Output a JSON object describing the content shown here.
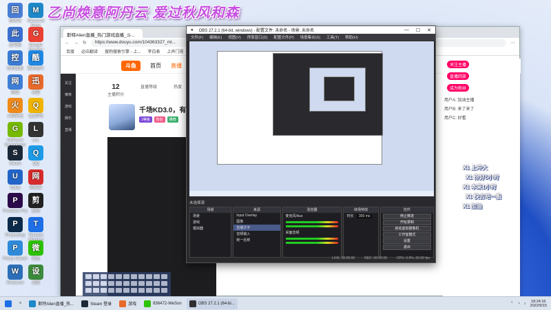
{
  "overlay": {
    "banner_text": "乙尚焕意阿丹云 爱过秋风和森"
  },
  "desktop_icons": [
    {
      "label": "回收站",
      "color": "#4a7fd8"
    },
    {
      "label": "Microsoft Edge",
      "color": "#1e88c8"
    },
    {
      "label": "此电脑",
      "color": "#3a6fd0"
    },
    {
      "label": "Google Chrome",
      "color": "#e94235"
    },
    {
      "label": "控制面板",
      "color": "#3b7bd4"
    },
    {
      "label": "酷狗音乐",
      "color": "#1e88e5"
    },
    {
      "label": "网络",
      "color": "#3f7fd6"
    },
    {
      "label": "迅雷",
      "color": "#e86a2b"
    },
    {
      "label": "火绒安全",
      "color": "#f08a1a"
    },
    {
      "label": "QQ游戏",
      "color": "#f0b400"
    },
    {
      "label": "GeForce Experience",
      "color": "#76b900"
    },
    {
      "label": "LoL",
      "color": "#333333"
    },
    {
      "label": "Steam",
      "color": "#1b2838"
    },
    {
      "label": "QQ",
      "color": "#1e9be6"
    },
    {
      "label": "Uplay",
      "color": "#2364c8"
    },
    {
      "label": "网易云",
      "color": "#d82b2b"
    },
    {
      "label": "Premiere Pro",
      "color": "#2a0a4a"
    },
    {
      "label": "剪映",
      "color": "#222222"
    },
    {
      "label": "Photoshop",
      "color": "#0b2a4a"
    },
    {
      "label": "Tencent Meeting",
      "color": "#1f6fe6"
    },
    {
      "label": "Photo Viewer",
      "color": "#2f8ad8"
    },
    {
      "label": "微信",
      "color": "#2dc100"
    },
    {
      "label": "WeGame",
      "color": "#2c6fb8"
    },
    {
      "label": "设置",
      "color": "#3c8b3c"
    }
  ],
  "browser": {
    "tab_title": "斯特Alien直播_热门游戏直播_斗...",
    "url": "https://www.douyu.com/104363327_ml...",
    "bookmarks": [
      "百度",
      "必应翻译",
      "搜狗搜索引擎 - 上...",
      "李白表",
      "上声门视"
    ],
    "site_logo": "斗鱼",
    "nav": [
      "首页",
      "直播"
    ],
    "stats": [
      {
        "value": "12",
        "label": "主播积分"
      },
      {
        "value": "",
        "label": "直播等级"
      },
      {
        "value": "",
        "label": "热度"
      }
    ],
    "card_title": "千场KD3.0，有车位",
    "card_tags": [
      {
        "text": "1等级",
        "color": "#7c4ad8"
      },
      {
        "text": "粉丝",
        "color": "#f05a8a"
      },
      {
        "text": "推荐",
        "color": "#40b070"
      }
    ],
    "side_nav": [
      "关注",
      "推荐",
      "游戏",
      "娱乐",
      "直播"
    ]
  },
  "chat": {
    "buttons": [
      "关注主播",
      "直播回放",
      "成为粉丝"
    ],
    "lines": [
      "用户A: 加油主播",
      "用户B: 来了来了",
      "用户C: 好看"
    ],
    "danmaku": [
      "X1 上冲大",
      "X1 你好5小时",
      "X1 本来1小时",
      "X1 快去吧一般",
      "X1 加油"
    ]
  },
  "obs": {
    "title": "OBS 27.2.1 (64-bit, windows) - 配置文件: 未命名 - 场景: 未命名",
    "menu": [
      "文件(F)",
      "编辑(E)",
      "视图(V)",
      "停靠窗口(D)",
      "配置文件(P)",
      "场景集合(S)",
      "工具(T)",
      "帮助(H)"
    ],
    "no_source": "未选择源",
    "docks": {
      "scenes": {
        "title": "场景",
        "items": [
          "场景",
          "游戏",
          "模拟器"
        ]
      },
      "sources": {
        "title": "来源",
        "items": [
          "Input Overlay",
          "图像",
          "直播文字",
          "音频输入",
          "统一名称"
        ]
      },
      "mixer": {
        "title": "混音器",
        "items": [
          "麦克风/Aux",
          "桌面音频"
        ]
      },
      "transitions": {
        "title": "转场特效",
        "duration_label": "时长",
        "duration": "300 ms"
      },
      "controls": {
        "title": "控件",
        "buttons": [
          "停止推流",
          "开始录制",
          "启动虚拟摄像机",
          "工作室模式",
          "设置",
          "退出"
        ]
      }
    },
    "status": {
      "live": "LIVE: 00:00:00",
      "rec": "REC: 00:00:00",
      "cpu": "CPU: 0.9%, 60.00 fps"
    }
  },
  "taskbar": {
    "items": [
      {
        "label": "斯特Alien直播_热...",
        "color": "#1e88c8",
        "active": false
      },
      {
        "label": "Steam 登录",
        "color": "#1b2838",
        "active": false
      },
      {
        "label": "游戏",
        "color": "#e86a2b",
        "active": false
      },
      {
        "label": "836472-WeSon",
        "color": "#2dc100",
        "active": false
      },
      {
        "label": "OBS 27.2.1 (64-bi...",
        "color": "#302e31",
        "active": true
      }
    ],
    "time": "18:24:16",
    "date": "2022/9/15"
  }
}
